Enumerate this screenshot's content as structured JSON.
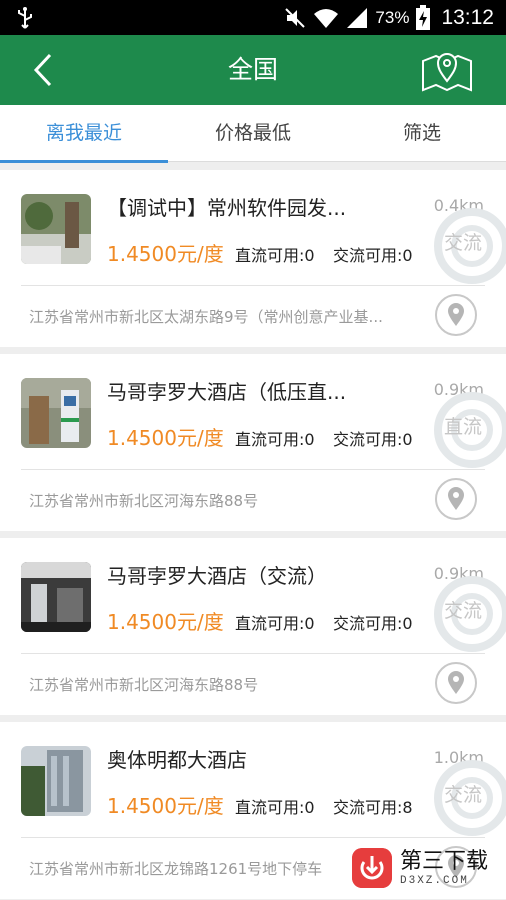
{
  "status_bar": {
    "battery_percent": "73%",
    "time": "13:12",
    "icons": [
      "usb-icon",
      "mute-icon",
      "wifi-icon",
      "signal-icon",
      "battery-charging-icon"
    ]
  },
  "app_bar": {
    "title": "全国",
    "back_icon": "back-chevron-icon",
    "map_icon": "map-pin-icon"
  },
  "tabs": [
    {
      "label": "离我最近",
      "active": true
    },
    {
      "label": "价格最低",
      "active": false
    },
    {
      "label": "筛选",
      "active": false
    }
  ],
  "stations": [
    {
      "name": "【调试中】常州软件园发...",
      "distance": "0.4km",
      "type": "交流",
      "price": "1.4500元/度",
      "dc": "直流可用:0",
      "ac": "交流可用:0",
      "address": "江苏省常州市新北区太湖东路9号（常州创意产业基..."
    },
    {
      "name": "马哥孛罗大酒店（低压直...",
      "distance": "0.9km",
      "type": "直流",
      "price": "1.4500元/度",
      "dc": "直流可用:0",
      "ac": "交流可用:0",
      "address": "江苏省常州市新北区河海东路88号"
    },
    {
      "name": "马哥孛罗大酒店（交流）",
      "distance": "0.9km",
      "type": "交流",
      "price": "1.4500元/度",
      "dc": "直流可用:0",
      "ac": "交流可用:0",
      "address": "江苏省常州市新北区河海东路88号"
    },
    {
      "name": "奥体明都大酒店",
      "distance": "1.0km",
      "type": "交流",
      "price": "1.4500元/度",
      "dc": "直流可用:0",
      "ac": "交流可用:8",
      "address": "江苏省常州市新北区龙锦路1261号地下停车"
    }
  ],
  "promo": {
    "line1": "第三下载",
    "line2": "D3XZ.COM"
  },
  "colors": {
    "primary_green": "#1e8a4c",
    "tab_active": "#3b8fd8",
    "price_orange": "#f08a24"
  }
}
